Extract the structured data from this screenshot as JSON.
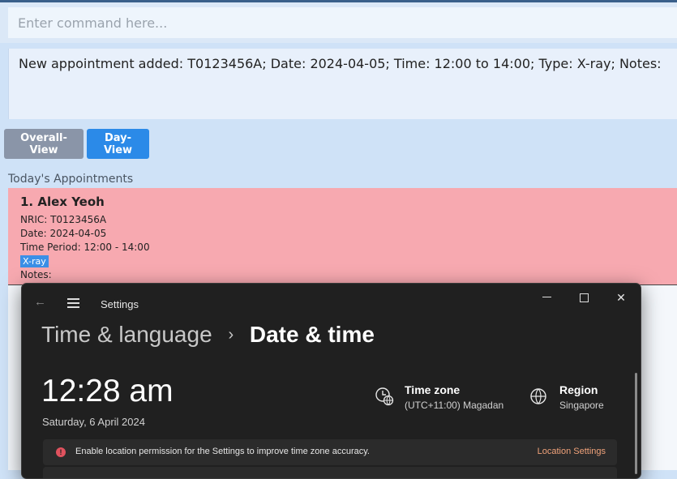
{
  "command": {
    "placeholder": "Enter command here..."
  },
  "result": {
    "text": "New appointment added: T0123456A; Date: 2024-04-05; Time: 12:00 to 14:00; Type: X-ray; Notes:"
  },
  "views": {
    "overall_label": "Overall-View",
    "day_label": "Day-View"
  },
  "appointments": {
    "section_title": "Today's Appointments",
    "items": [
      {
        "index": "1.",
        "name": "Alex Yeoh",
        "nric": "NRIC: T0123456A",
        "date": "Date: 2024-04-05",
        "time_period": "Time Period: 12:00 - 14:00",
        "tag": "X-ray",
        "notes": "Notes:"
      }
    ]
  },
  "settings_window": {
    "title": "Settings",
    "breadcrumb_parent": "Time & language",
    "breadcrumb_separator": "›",
    "breadcrumb_current": "Date & time",
    "time": "12:28 am",
    "date": "Saturday, 6 April 2024",
    "timezone_label": "Time zone",
    "timezone_value": "(UTC+11:00) Magadan",
    "region_label": "Region",
    "region_value": "Singapore",
    "notice_text": "Enable location permission for the Settings to improve time zone accuracy.",
    "notice_link": "Location Settings",
    "icons": {
      "back": "back-arrow-icon",
      "menu": "hamburger-menu-icon",
      "minimize": "minimize-icon",
      "maximize": "maximize-icon",
      "close": "close-icon",
      "timezone": "clock-globe-icon",
      "region": "globe-icon",
      "warning": "error-icon"
    }
  },
  "colors": {
    "appointment_card": "#f7a9b0",
    "day_view_button": "#2b8ae8",
    "overall_view_button": "#8a95a8",
    "tag": "#3b8fe6",
    "settings_bg": "#202020",
    "notice_link": "#f0a27a"
  }
}
